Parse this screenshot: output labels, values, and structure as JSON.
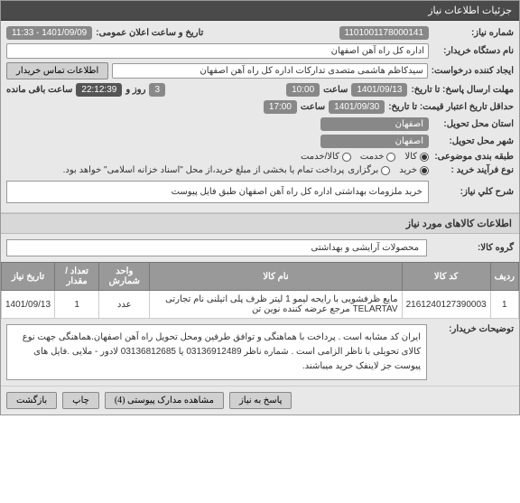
{
  "page_title": "جزئیات اطلاعات نیاز",
  "fields": {
    "need_number_label": "شماره نیاز:",
    "need_number": "1101001178000141",
    "announce_datetime_label": "تاریخ و ساعت اعلان عمومی:",
    "announce_datetime": "1401/09/09 - 11:33",
    "buyer_org_label": "نام دستگاه خریدار:",
    "buyer_org": "اداره کل راه آهن اصفهان",
    "requester_label": "ایجاد کننده درخواست:",
    "requester": "سیدکاظم هاشمی متصدی تدارکات اداره کل راه آهن اصفهان",
    "contact_btn": "اطلاعات تماس خریدار",
    "deadline_label": "مهلت ارسال پاسخ: تا تاریخ:",
    "deadline_date": "1401/09/13",
    "deadline_time_label": "ساعت",
    "deadline_time": "10:00",
    "days_label": "روز و",
    "days": "3",
    "countdown": "22:12:39",
    "remaining_label": "ساعت باقی مانده",
    "validity_label": "حداقل تاریخ اعتبار قیمت: تا تاریخ:",
    "validity_date": "1401/09/30",
    "validity_time_label": "ساعت",
    "validity_time": "17:00",
    "province_label": "استان محل تحویل:",
    "province": "اصفهان",
    "city_label": "شهر محل تحویل:",
    "city": "اصفهان",
    "category_label": "طبقه بندی موضوعی:",
    "cat_goods": "کالا",
    "cat_service": "خدمت",
    "cat_both": "کالا/خدمت",
    "process_label": "نوع فرآیند خرید :",
    "proc_buy": "خرید",
    "proc_reverse": "برگزاری",
    "proc_note": "پرداخت تمام یا بخشی از مبلغ خرید،از محل \"اسناد خزانه اسلامی\" خواهد بود.",
    "summary_label": "شرح کلي نیاز:",
    "summary": "خرید ملزومات بهداشتی اداره کل راه آهن اصفهان طبق فایل پیوست",
    "goods_section": "اطلاعات کالاهای مورد نیاز",
    "goods_group_label": "گروه کالا:",
    "goods_group": "محصولات آرایشی و بهداشتی",
    "buyer_notes_label": "توضیحات خریدار:",
    "buyer_notes": "ایران کد مشابه است . پرداخت با هماهنگی و توافق طرفین ومحل تحویل راه آهن اصفهان.هماهنگی جهت نوع کالای تحویلی با ناظر الزامی است . شماره ناظر 03136912489 یا 03136812685 لادور - ملایی .فایل های پیوست جز لاینفک خرید میباشند."
  },
  "table": {
    "headers": {
      "row": "ردیف",
      "code": "کد کالا",
      "name": "نام کالا",
      "unit": "واحد شمارش",
      "qty": "تعداد / مقدار",
      "date": "تاریخ نیاز"
    },
    "rows": [
      {
        "row": "1",
        "code": "2161240127390003",
        "name": "مایع ظرفشویی با رایحه لیمو 1 لیتر ظرف پلی اتیلنی نام تجارتی TELARTAV مرجع عرضه کننده نوین تن",
        "unit": "عدد",
        "qty": "1",
        "date": "1401/09/13"
      }
    ]
  },
  "footer": {
    "reply": "پاسخ به نیاز",
    "attachments": "مشاهده مدارک پیوستی (4)",
    "print": "چاپ",
    "back": "بازگشت"
  }
}
